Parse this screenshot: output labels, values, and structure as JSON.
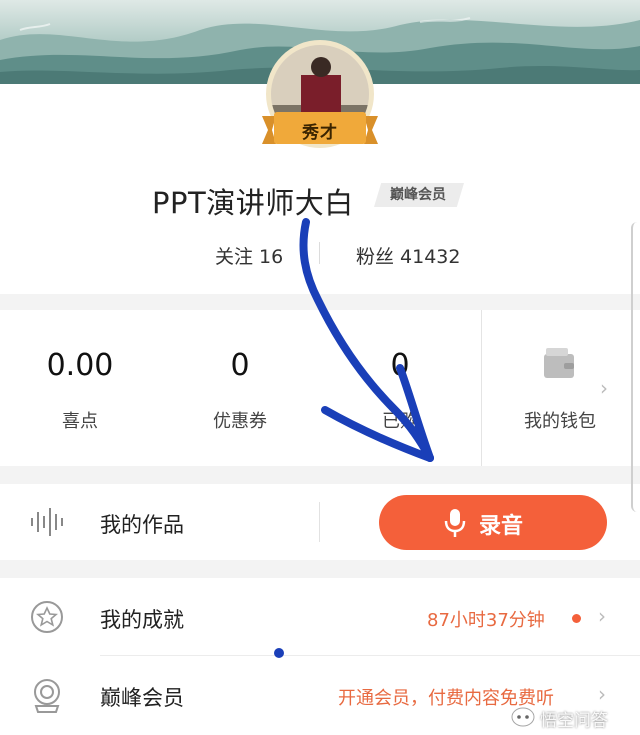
{
  "profile": {
    "title_badge": "秀才",
    "username": "PPT演讲师大白",
    "vip_badge": "巅峰会员",
    "following": "关注 16",
    "fans": "粉丝 41432"
  },
  "wallet": {
    "stats": [
      {
        "value": "0.00",
        "label": "喜点"
      },
      {
        "value": "0",
        "label": "优惠券"
      },
      {
        "value": "0",
        "label": "已购"
      }
    ],
    "wallet_label": "我的钱包",
    "chevron": "›"
  },
  "works": {
    "label": "我的作品",
    "record_label": "录音"
  },
  "list": {
    "achievements": {
      "label": "我的成就",
      "value": "87小时37分钟",
      "chevron": "›"
    },
    "membership": {
      "label": "巅峰会员",
      "value": "开通会员，付费内容免费听",
      "chevron": "›"
    }
  },
  "watermark": "悟空问答",
  "icons": {
    "waveform": "waveform-icon",
    "mic": "microphone-icon",
    "wallet": "wallet-icon",
    "star": "star-badge-icon",
    "medal": "medal-icon"
  },
  "colors": {
    "accent": "#f4603a",
    "accent_text": "#e86a41",
    "annotation": "#1a3fb8"
  }
}
